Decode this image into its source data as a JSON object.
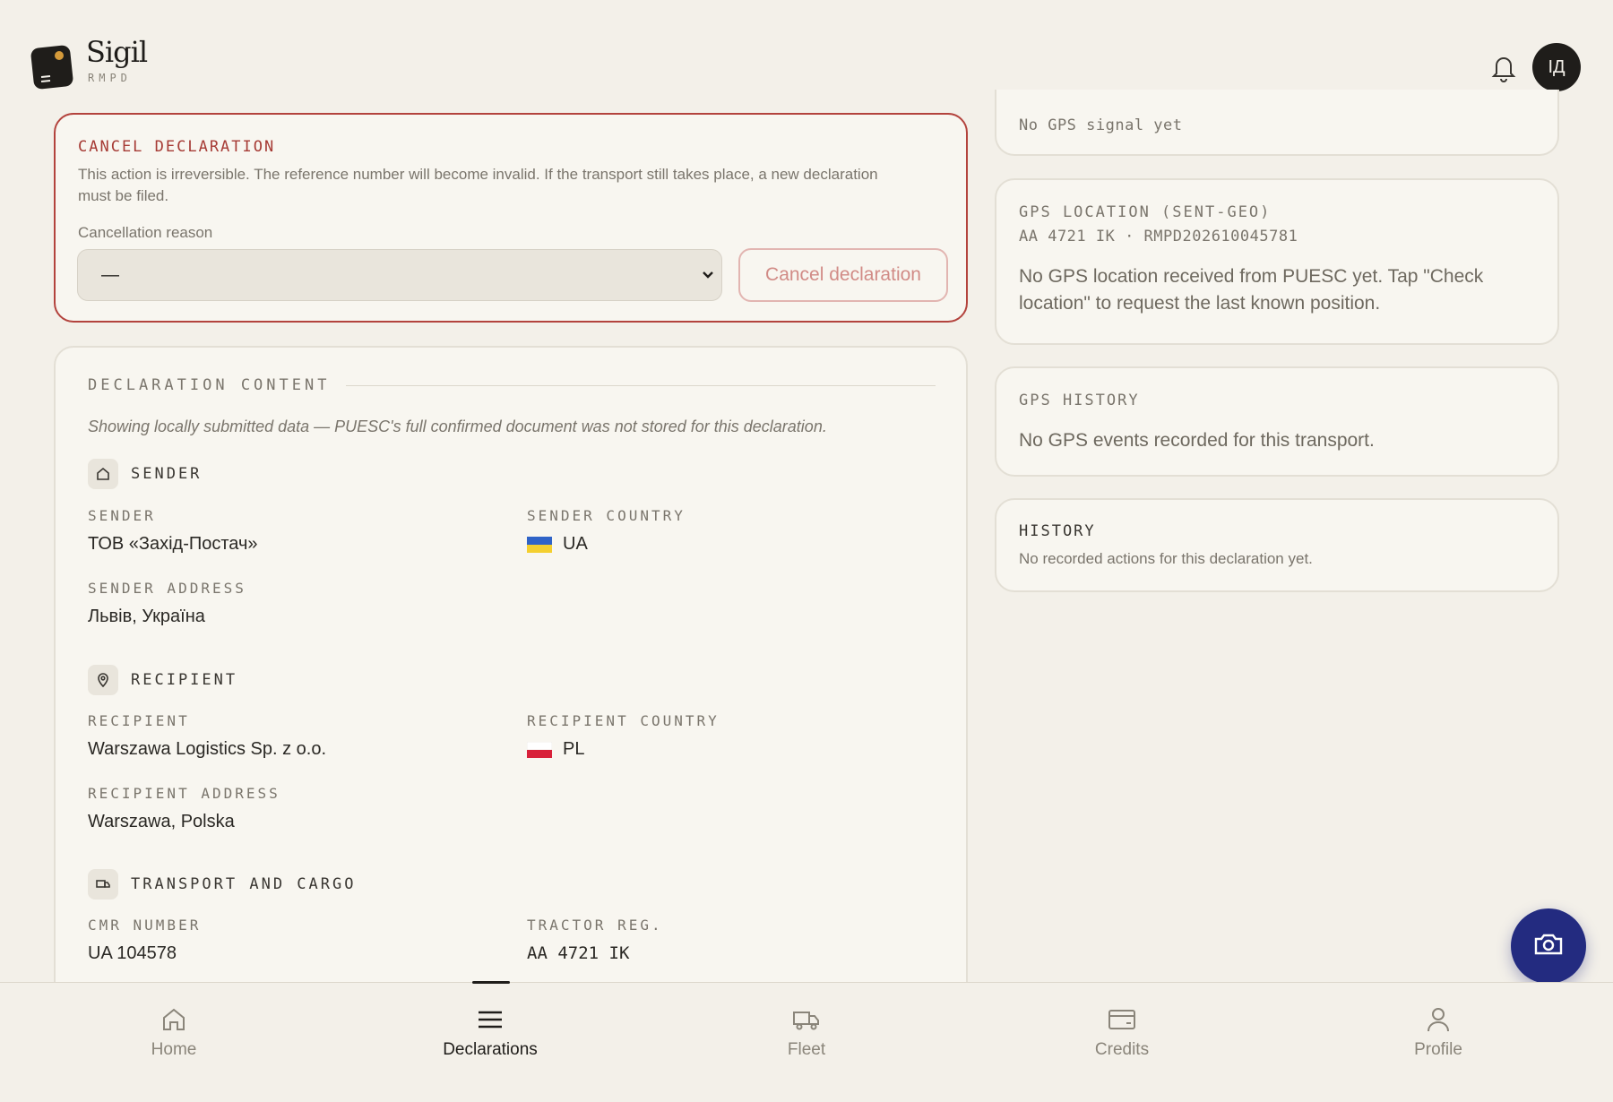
{
  "app": {
    "name": "Sigil",
    "subtitle": "RMPD"
  },
  "header": {
    "avatar_initials": "ІД"
  },
  "cancel": {
    "title": "CANCEL DECLARATION",
    "description": "This action is irreversible. The reference number will become invalid. If the transport still takes place, a new declaration must be filed.",
    "reason_label": "Cancellation reason",
    "reason_value": "—",
    "button_label": "Cancel declaration"
  },
  "content": {
    "title": "DECLARATION CONTENT",
    "notice": "Showing locally submitted data — PUESC's full confirmed document was not stored for this declaration.",
    "sender": {
      "title": "SENDER",
      "name_label": "SENDER",
      "name": "ТОВ «Захід-Постач»",
      "country_label": "SENDER COUNTRY",
      "country": "UA",
      "address_label": "SENDER ADDRESS",
      "address": "Львів, Україна"
    },
    "recipient": {
      "title": "RECIPIENT",
      "name_label": "RECIPIENT",
      "name": "Warszawa Logistics Sp. z o.o.",
      "country_label": "RECIPIENT COUNTRY",
      "country": "PL",
      "address_label": "RECIPIENT ADDRESS",
      "address": "Warszawa, Polska"
    },
    "transport": {
      "title": "TRANSPORT AND CARGO",
      "cmr_label": "CMR NUMBER",
      "cmr": "UA 104578",
      "tractor_label": "TRACTOR REG.",
      "tractor": "AA 4721 IK"
    }
  },
  "gps_status": {
    "text": "No GPS signal yet"
  },
  "gps_location": {
    "title": "GPS LOCATION (SENT-GEO)",
    "ref": "AA 4721 IK · RMPD202610045781",
    "message": "No GPS location received from PUESC yet. Tap \"Check location\" to request the last known position."
  },
  "gps_history": {
    "title": "GPS HISTORY",
    "message": "No GPS events recorded for this transport."
  },
  "history": {
    "title": "HISTORY",
    "message": "No recorded actions for this declaration yet."
  },
  "nav": {
    "home": "Home",
    "declarations": "Declarations",
    "fleet": "Fleet",
    "credits": "Credits",
    "profile": "Profile"
  },
  "colors": {
    "danger": "#a63b35",
    "accent": "#232b80",
    "ink": "#1f1d1a"
  },
  "icons": [
    "bell-icon",
    "home-outline-icon",
    "map-pin-icon",
    "truck-icon",
    "camera-icon",
    "menu-icon",
    "credit-card-icon",
    "user-icon",
    "chevron-down-icon"
  ]
}
